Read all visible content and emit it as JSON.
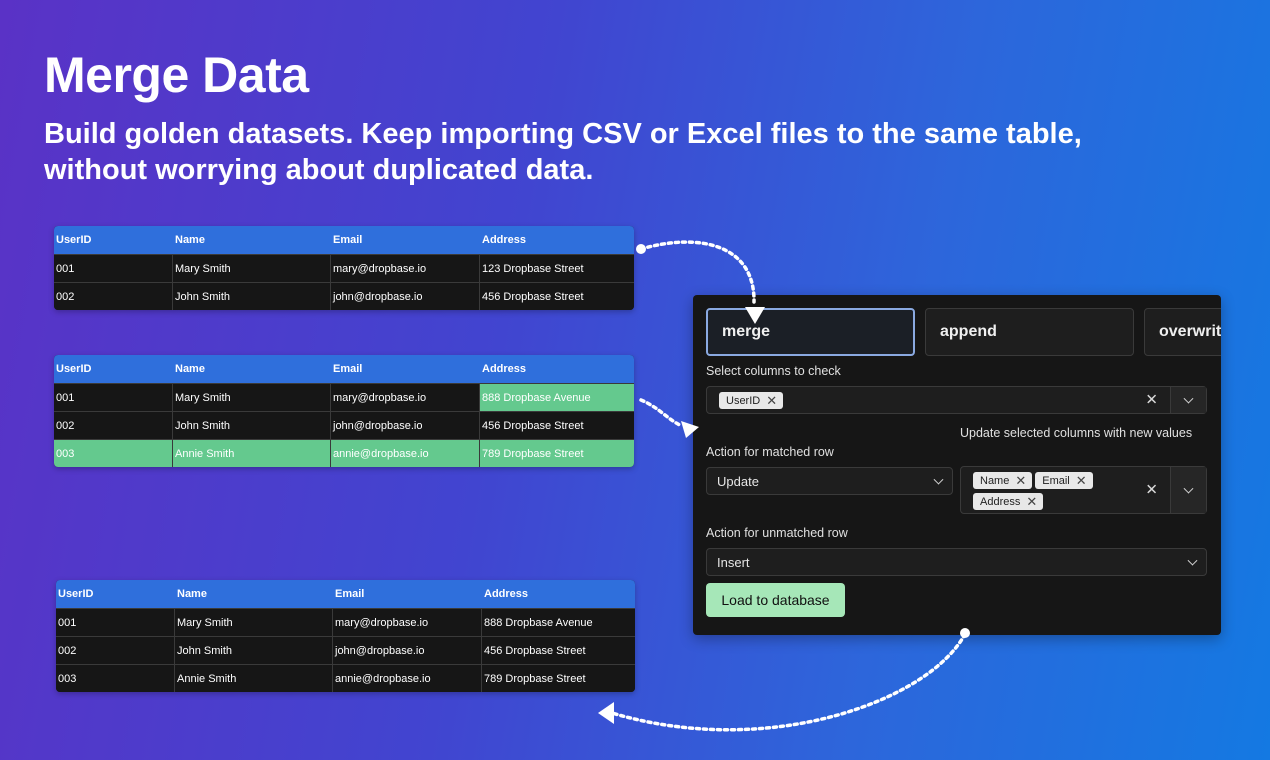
{
  "hero": {
    "title": "Merge Data",
    "subtitle": "Build golden datasets. Keep importing CSV or Excel files to the same table, without worrying about duplicated data."
  },
  "tables": {
    "columns": [
      "UserID",
      "Name",
      "Email",
      "Address"
    ],
    "existing": [
      [
        "001",
        "Mary Smith",
        "mary@dropbase.io",
        "123 Dropbase Street"
      ],
      [
        "002",
        "John Smith",
        "john@dropbase.io",
        "456 Dropbase Street"
      ]
    ],
    "incoming": [
      [
        "001",
        "Mary Smith",
        "mary@dropbase.io",
        "888 Dropbase Avenue"
      ],
      [
        "002",
        "John Smith",
        "john@dropbase.io",
        "456 Dropbase Street"
      ],
      [
        "003",
        "Annie Smith",
        "annie@dropbase.io",
        "789 Dropbase Street"
      ]
    ],
    "result": [
      [
        "001",
        "Mary Smith",
        "mary@dropbase.io",
        "888 Dropbase Avenue"
      ],
      [
        "002",
        "John Smith",
        "john@dropbase.io",
        "456 Dropbase Street"
      ],
      [
        "003",
        "Annie Smith",
        "annie@dropbase.io",
        "789 Dropbase Street"
      ]
    ]
  },
  "panel": {
    "tabs": [
      "merge",
      "append",
      "overwrite"
    ],
    "active_tab": "merge",
    "check_columns_label": "Select columns to check",
    "check_columns_chips": [
      "UserID"
    ],
    "matched_label": "Action for matched row",
    "matched_value": "Update",
    "update_cols_label": "Update selected columns with new values",
    "update_cols_chips": [
      "Name",
      "Email",
      "Address"
    ],
    "unmatched_label": "Action for unmatched row",
    "unmatched_value": "Insert",
    "load_button": "Load to database"
  },
  "colors": {
    "header_blue": "#2f6fdc",
    "highlight_green": "#64c98e",
    "button_green": "#a6e7b8",
    "panel_bg": "#161616"
  }
}
